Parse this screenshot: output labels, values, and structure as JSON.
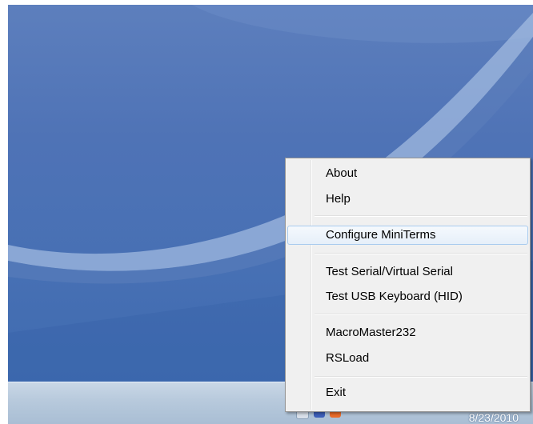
{
  "desktop": {
    "background_color": "#4a72b5"
  },
  "context_menu": {
    "items": [
      {
        "label": "About"
      },
      {
        "label": "Help"
      },
      {
        "label": "Configure MiniTerms"
      },
      {
        "label": "Test Serial/Virtual Serial"
      },
      {
        "label": "Test USB Keyboard (HID)"
      },
      {
        "label": "MacroMaster232"
      },
      {
        "label": "RSLoad"
      },
      {
        "label": "Exit"
      }
    ],
    "highlighted_item": "Configure MiniTerms",
    "highlight_color": "#cfe3f8"
  },
  "taskbar": {
    "date": "8/23/2010",
    "tray_icons": [
      {
        "icon": "app-tray-icon"
      },
      {
        "icon": "network-tray-icon"
      },
      {
        "icon": "volume-tray-icon"
      }
    ]
  }
}
